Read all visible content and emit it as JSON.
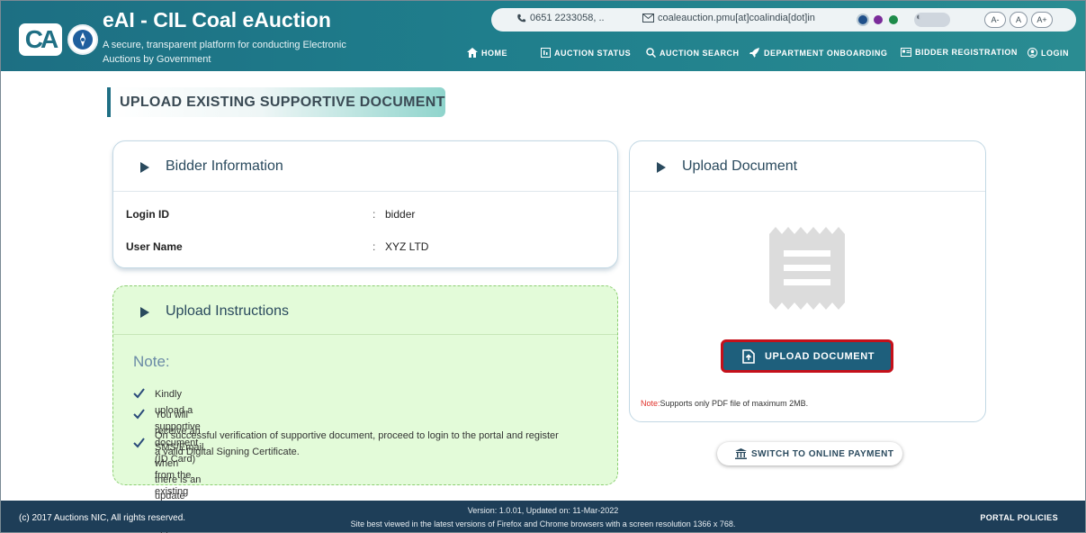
{
  "header": {
    "logo_text": "CA",
    "title": "eAI - CIL Coal eAuction",
    "subtitle": "A secure, transparent platform for conducting Electronic Auctions by Government",
    "phone": "0651 2233058, ..",
    "email": "coaleauction.pmu[at]coalindia[dot]in",
    "theme_colors": [
      "#1f4f8a",
      "#7a2b9a",
      "#1e8b4a"
    ],
    "font_sizes": [
      "A-",
      "A",
      "A+"
    ],
    "nav": [
      {
        "label": "HOME",
        "icon": "home-icon"
      },
      {
        "label": "AUCTION STATUS",
        "icon": "status-icon"
      },
      {
        "label": "AUCTION SEARCH",
        "icon": "search-icon"
      },
      {
        "label": "DEPARTMENT ONBOARDING",
        "icon": "rocket-icon"
      },
      {
        "label": "BIDDER REGISTRATION",
        "icon": "id-card-icon"
      },
      {
        "label": "LOGIN",
        "icon": "user-icon"
      }
    ]
  },
  "page": {
    "title": "UPLOAD EXISTING SUPPORTIVE DOCUMENT"
  },
  "bidder": {
    "heading": "Bidder Information",
    "rows": [
      {
        "label": "Login ID",
        "value": "bidder"
      },
      {
        "label": "User Name",
        "value": "XYZ LTD"
      }
    ]
  },
  "instructions": {
    "heading": "Upload Instructions",
    "note_title": "Note:",
    "items": [
      "Kindly upload a supportive document (ID Card) from the existing service provider.",
      "You will receive an SMS/Email when there is an update during the approval process.",
      "On successful verification of supportive document, proceed to login to the portal and register",
      "a valid Digital Signing Certificate."
    ]
  },
  "upload": {
    "heading": "Upload Document",
    "button_label": "UPLOAD DOCUMENT",
    "note_prefix": "Note:",
    "note_text": "Supports only PDF file of maximum 2MB."
  },
  "switch_button": "SWITCH TO ONLINE PAYMENT",
  "footer": {
    "copyright": "(c) 2017 Auctions NIC, All rights reserved.",
    "version": "Version: 1.0.01, Updated on: 11-Mar-2022",
    "best_view": "Site best viewed in the latest versions of Firefox and Chrome browsers with a screen resolution 1366 x 768.",
    "policies": "PORTAL POLICIES"
  },
  "colors": {
    "header": "#1f7e8c",
    "footer": "#1e3e58",
    "button": "#1e5f7c",
    "highlight": "#c5101a",
    "instructions_bg": "#e3fbd9"
  }
}
